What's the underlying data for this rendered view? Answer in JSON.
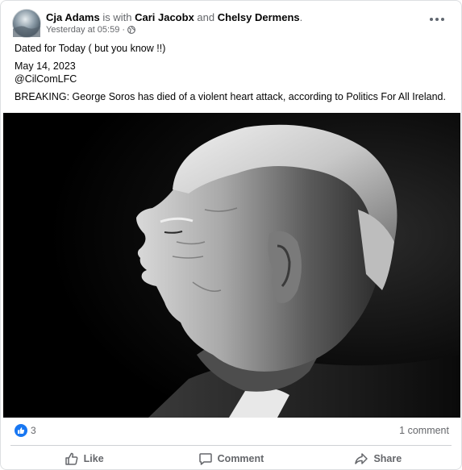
{
  "post": {
    "author": "Cja Adams",
    "with_text": "is with",
    "tagged_1": "Cari Jacobx",
    "and_text": "and",
    "tagged_2": "Chelsy Dermens",
    "period": ".",
    "timestamp": "Yesterday at 05:59",
    "separator": "·",
    "audience_icon": "globe-icon",
    "more_icon": "more-options-icon",
    "lines": [
      "Dated for Today ( but you know !!)",
      "May 14, 2023",
      "@CilComLFC",
      "BREAKING: George Soros has died of a violent heart attack, according to Politics For All Ireland."
    ]
  },
  "image": {
    "description_icon": "portrait-photo"
  },
  "stats": {
    "reaction_icon": "like-reaction-icon",
    "reaction_count": "3",
    "comments": "1 comment"
  },
  "actions": {
    "like_label": "Like",
    "comment_label": "Comment",
    "share_label": "Share"
  },
  "colors": {
    "accent": "#1877f2",
    "muted": "#65676b",
    "text": "#050505"
  }
}
